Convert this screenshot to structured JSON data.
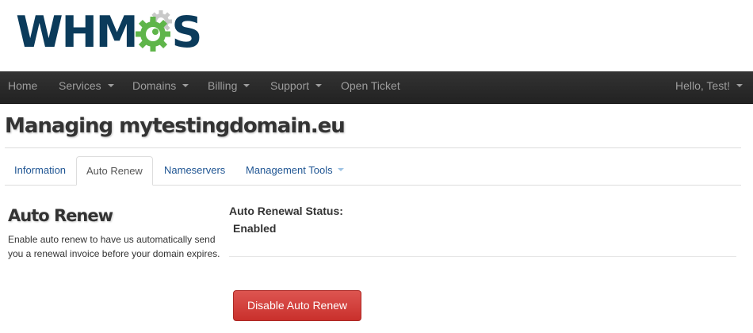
{
  "brand": {
    "logo_prefix": "WHM",
    "logo_suffix": "S",
    "logo_colors": {
      "text": "#0b3b5b",
      "gear": "#5fb54a",
      "gear_inner": "#c9c9c9"
    }
  },
  "navbar": {
    "items": [
      {
        "label": "Home",
        "has_dropdown": false
      },
      {
        "label": "Services",
        "has_dropdown": true
      },
      {
        "label": "Domains",
        "has_dropdown": true
      },
      {
        "label": "Billing",
        "has_dropdown": true
      },
      {
        "label": "Support",
        "has_dropdown": true
      },
      {
        "label": "Open Ticket",
        "has_dropdown": false
      }
    ],
    "user_menu": "Hello, Test!"
  },
  "page": {
    "title": "Managing mytestingdomain.eu"
  },
  "tabs": [
    {
      "label": "Information",
      "active": false
    },
    {
      "label": "Auto Renew",
      "active": true
    },
    {
      "label": "Nameservers",
      "active": false
    },
    {
      "label": "Management Tools",
      "active": false,
      "has_dropdown": true
    }
  ],
  "auto_renew": {
    "heading": "Auto Renew",
    "description": "Enable auto renew to have us automatically send you a renewal invoice before your domain expires.",
    "status_label": "Auto Renewal Status:",
    "status_value": "Enabled",
    "action_button": "Disable Auto Renew",
    "action_color": "#d9534f"
  }
}
